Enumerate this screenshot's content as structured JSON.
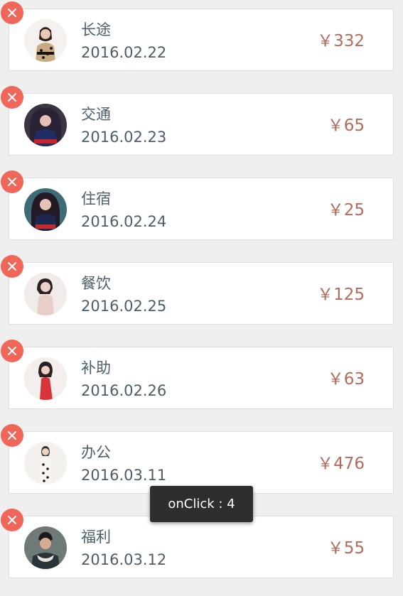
{
  "colors": {
    "background": "#efefef",
    "card": "#ffffff",
    "text": "#4b5e6a",
    "amount": "#b36b5e",
    "delete": "#f0675a",
    "toast_bg": "#2e2e2e"
  },
  "items": [
    {
      "title": "长途",
      "date": "2016.02.22",
      "amount": "￥332",
      "avatar": "woman-portrait-icon"
    },
    {
      "title": "交通",
      "date": "2016.02.23",
      "amount": "￥65",
      "avatar": "woman-portrait-icon"
    },
    {
      "title": "住宿",
      "date": "2016.02.24",
      "amount": "￥25",
      "avatar": "woman-portrait-icon"
    },
    {
      "title": "餐饮",
      "date": "2016.02.25",
      "amount": "￥125",
      "avatar": "woman-portrait-icon"
    },
    {
      "title": "补助",
      "date": "2016.02.26",
      "amount": "￥63",
      "avatar": "woman-portrait-icon"
    },
    {
      "title": "办公",
      "date": "2016.03.11",
      "amount": "￥476",
      "avatar": "woman-portrait-icon"
    },
    {
      "title": "福利",
      "date": "2016.03.12",
      "amount": "￥55",
      "avatar": "man-portrait-icon"
    }
  ],
  "delete_icon": "close-icon",
  "toast": {
    "text": "onClick : 4"
  }
}
